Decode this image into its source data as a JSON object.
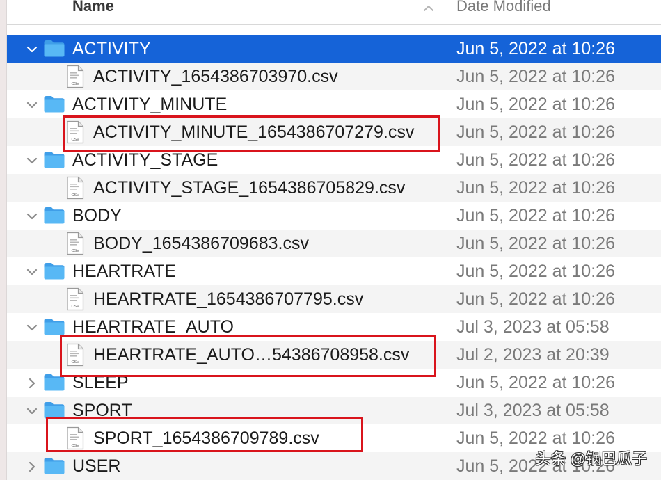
{
  "header": {
    "name_label": "Name",
    "date_label": "Date Modified",
    "sort_icon": "chevron-up-icon"
  },
  "rows": [
    {
      "kind": "folder",
      "name": "ACTIVITY",
      "date": "Jun 5, 2022 at 10:26",
      "expanded": true,
      "selected": true
    },
    {
      "kind": "file",
      "name": "ACTIVITY_1654386703970.csv",
      "date": "Jun 5, 2022 at 10:26"
    },
    {
      "kind": "folder",
      "name": "ACTIVITY_MINUTE",
      "date": "Jun 5, 2022 at 10:26",
      "expanded": true
    },
    {
      "kind": "file",
      "name": "ACTIVITY_MINUTE_1654386707279.csv",
      "date": "Jun 5, 2022 at 10:26"
    },
    {
      "kind": "folder",
      "name": "ACTIVITY_STAGE",
      "date": "Jun 5, 2022 at 10:26",
      "expanded": true
    },
    {
      "kind": "file",
      "name": "ACTIVITY_STAGE_1654386705829.csv",
      "date": "Jun 5, 2022 at 10:26"
    },
    {
      "kind": "folder",
      "name": "BODY",
      "date": "Jun 5, 2022 at 10:26",
      "expanded": true
    },
    {
      "kind": "file",
      "name": "BODY_1654386709683.csv",
      "date": "Jun 5, 2022 at 10:26"
    },
    {
      "kind": "folder",
      "name": "HEARTRATE",
      "date": "Jun 5, 2022 at 10:26",
      "expanded": true
    },
    {
      "kind": "file",
      "name": "HEARTRATE_1654386707795.csv",
      "date": "Jun 5, 2022 at 10:26"
    },
    {
      "kind": "folder",
      "name": "HEARTRATE_AUTO",
      "date": "Jul 3, 2023 at 05:58",
      "expanded": true
    },
    {
      "kind": "file",
      "name": "HEARTRATE_AUTO…54386708958.csv",
      "date": "Jul 2, 2023 at 20:39"
    },
    {
      "kind": "folder",
      "name": "SLEEP",
      "date": "Jun 5, 2022 at 10:26",
      "expanded": false
    },
    {
      "kind": "folder",
      "name": "SPORT",
      "date": "Jul 3, 2023 at 05:58",
      "expanded": true
    },
    {
      "kind": "file",
      "name": "SPORT_1654386709789.csv",
      "date": "Jun 5, 2022 at 10:26"
    },
    {
      "kind": "folder",
      "name": "USER",
      "date": "Jun 5, 2022 at 10:26",
      "expanded": false
    }
  ],
  "watermark": "头条 @锅巴瓜子",
  "colors": {
    "selection": "#1563d8",
    "folder": "#58b8f5",
    "highlight": "#d9141c"
  }
}
